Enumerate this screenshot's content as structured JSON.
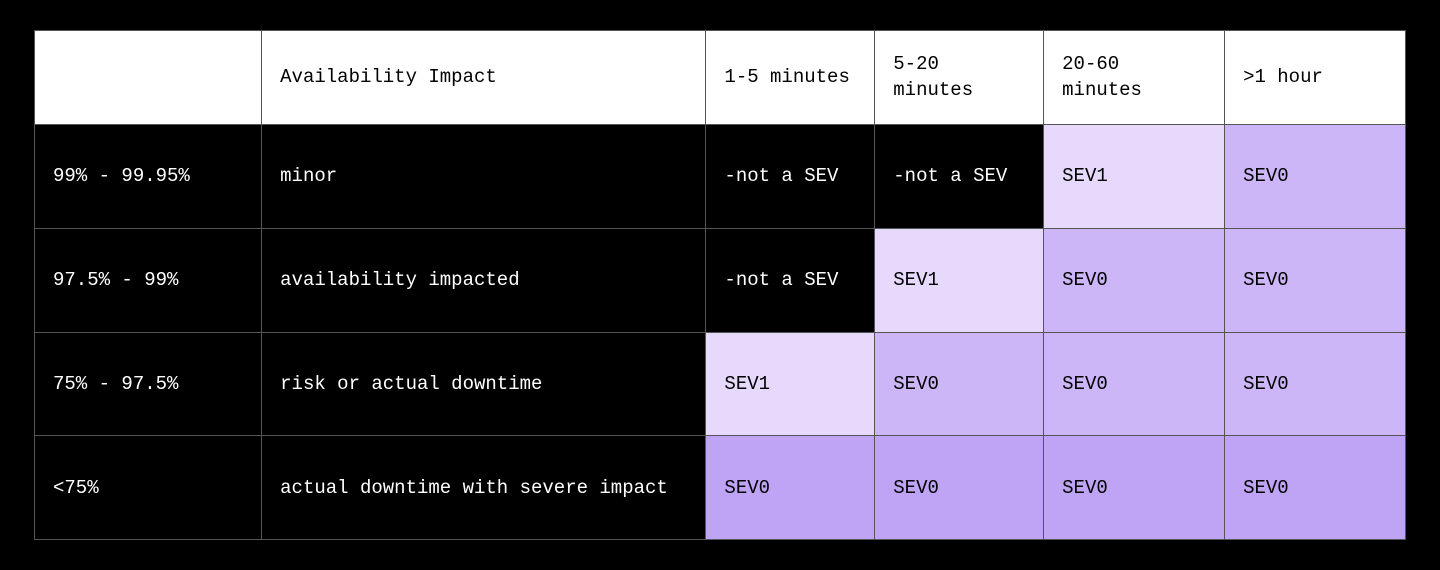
{
  "headers": {
    "c0": "",
    "c1": "Availability Impact",
    "c2": "1-5 minutes",
    "c3": "5-20 minutes",
    "c4": "20-60 minutes",
    "c5": ">1 hour"
  },
  "rows": [
    {
      "range": "99% - 99.95%",
      "impact": "minor",
      "cells": [
        {
          "label": "-not a SEV",
          "shade": "black"
        },
        {
          "label": "-not a SEV",
          "shade": "black"
        },
        {
          "label": "SEV1",
          "shade": "light"
        },
        {
          "label": "SEV0",
          "shade": "mid"
        }
      ]
    },
    {
      "range": "97.5% - 99%",
      "impact": "availability impacted",
      "cells": [
        {
          "label": "-not a SEV",
          "shade": "black"
        },
        {
          "label": "SEV1",
          "shade": "light"
        },
        {
          "label": "SEV0",
          "shade": "mid"
        },
        {
          "label": "SEV0",
          "shade": "mid"
        }
      ]
    },
    {
      "range": "75% - 97.5%",
      "impact": "risk or actual downtime",
      "cells": [
        {
          "label": "SEV1",
          "shade": "light"
        },
        {
          "label": "SEV0",
          "shade": "mid"
        },
        {
          "label": "SEV0",
          "shade": "mid"
        },
        {
          "label": "SEV0",
          "shade": "mid"
        }
      ]
    },
    {
      "range": "<75%",
      "impact": "actual downtime with severe impact",
      "cells": [
        {
          "label": "SEV0",
          "shade": "dark"
        },
        {
          "label": "SEV0",
          "shade": "dark"
        },
        {
          "label": "SEV0",
          "shade": "dark"
        },
        {
          "label": "SEV0",
          "shade": "dark"
        }
      ]
    }
  ]
}
